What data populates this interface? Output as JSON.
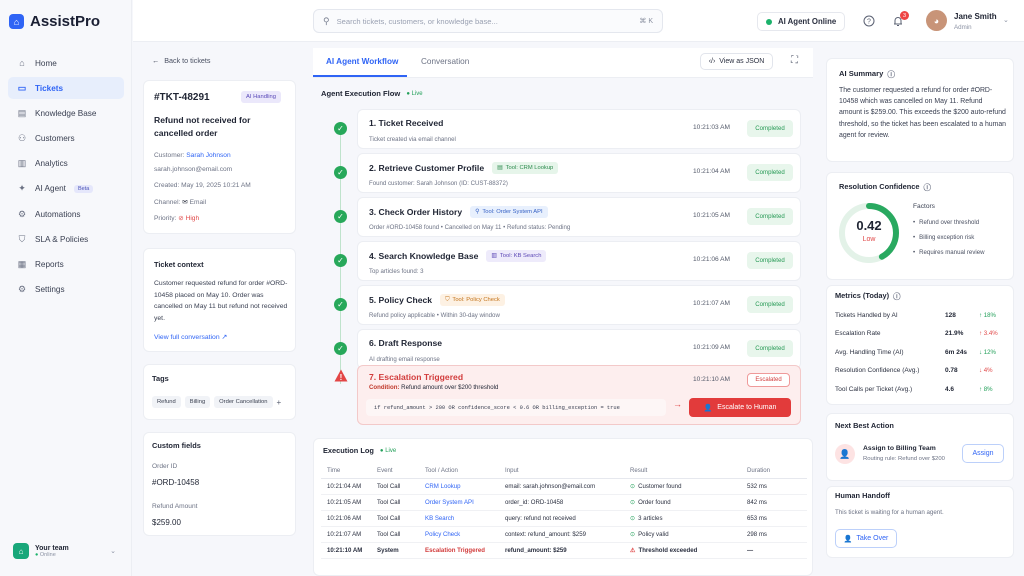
{
  "app": {
    "name": "AssistPro"
  },
  "sidebar": {
    "items": [
      {
        "label": "Home",
        "icon": "home-icon",
        "glyph": "⌂"
      },
      {
        "label": "Tickets",
        "icon": "ticket-icon",
        "glyph": "▭"
      },
      {
        "label": "Knowledge Base",
        "icon": "book-icon",
        "glyph": "▤"
      },
      {
        "label": "Customers",
        "icon": "users-icon",
        "glyph": "⚇"
      },
      {
        "label": "Analytics",
        "icon": "chart-icon",
        "glyph": "▥"
      },
      {
        "label": "AI Agent",
        "icon": "sparkle-icon",
        "glyph": "✦",
        "badge": "Beta"
      },
      {
        "label": "Automations",
        "icon": "gear-icon",
        "glyph": "⚙"
      },
      {
        "label": "SLA & Policies",
        "icon": "shield-icon",
        "glyph": "⛉"
      },
      {
        "label": "Reports",
        "icon": "report-icon",
        "glyph": "▦"
      },
      {
        "label": "Settings",
        "icon": "settings-icon",
        "glyph": "⚙"
      }
    ],
    "active_index": 1
  },
  "team": {
    "name": "Your team",
    "status": "Online"
  },
  "header": {
    "search_placeholder": "Search tickets, customers, or knowledge base...",
    "shortcut": "⌘ K",
    "ai_status": "AI Agent Online",
    "notifications": "3",
    "user_name": "Jane Smith",
    "user_role": "Admin"
  },
  "ticket": {
    "back": "Back to tickets",
    "id": "#TKT-48291",
    "handling": "AI Handling",
    "title": "Refund not received for cancelled order",
    "customer_label": "Customer:",
    "customer": "Sarah Johnson",
    "email": "sarah.johnson@email.com",
    "created": "Created: May 19, 2025 10:21 AM",
    "channel_label": "Channel:",
    "channel": "Email",
    "priority_label": "Priority:",
    "priority": "High"
  },
  "context": {
    "title": "Ticket context",
    "text": "Customer requested refund for order #ORD-10458 placed on May 10. Order was cancelled on May 11 but refund not received yet.",
    "link": "View full conversation"
  },
  "tags": {
    "title": "Tags",
    "items": [
      "Refund",
      "Billing",
      "Order Cancellation"
    ],
    "add": "+"
  },
  "custom": {
    "title": "Custom fields",
    "order_label": "Order ID",
    "order": "#ORD-10458",
    "amount_label": "Refund Amount",
    "amount": "$259.00"
  },
  "main": {
    "tabs": [
      "AI Agent Workflow",
      "Conversation"
    ],
    "view_json": "View as JSON",
    "flow_title": "Agent Execution Flow",
    "live": "Live"
  },
  "steps": [
    {
      "title": "1. Ticket Received",
      "sub": "Ticket created via email channel",
      "time": "10:21:03 AM",
      "status": "Completed"
    },
    {
      "title": "2. Retrieve Customer Profile",
      "tool": "Tool: CRM Lookup",
      "tool_class": "green",
      "tool_glyph": "▤",
      "sub": "Found customer: Sarah Johnson (ID: CUST-88372)",
      "time": "10:21:04 AM",
      "status": "Completed"
    },
    {
      "title": "3. Check Order History",
      "tool": "Tool: Order System API",
      "tool_class": "blue",
      "tool_glyph": "⚲",
      "sub": "Order #ORD-10458 found  •  Cancelled on May 11  •  Refund status: Pending",
      "time": "10:21:05 AM",
      "status": "Completed"
    },
    {
      "title": "4. Search Knowledge Base",
      "tool": "Tool: KB Search",
      "tool_class": "purple",
      "tool_glyph": "▥",
      "sub": "Top articles found: 3",
      "time": "10:21:06 AM",
      "status": "Completed"
    },
    {
      "title": "5. Policy Check",
      "tool": "Tool: Policy Check",
      "tool_class": "orange",
      "tool_glyph": "⛉",
      "sub": "Refund policy applicable  •  Within 30-day window",
      "time": "10:21:07 AM",
      "status": "Completed"
    },
    {
      "title": "6. Draft Response",
      "sub": "AI drafting email response",
      "time": "10:21:09 AM",
      "status": "Completed"
    }
  ],
  "escalation": {
    "title": "7. Escalation Triggered",
    "cond_label": "Condition:",
    "condition": "Refund amount over $200 threshold",
    "time": "10:21:10 AM",
    "status": "Escalated",
    "code": "if refund_amount > 200 OR confidence_score < 0.6 OR billing_exception = true",
    "button": "Escalate to Human"
  },
  "log": {
    "title": "Execution Log",
    "live": "Live",
    "headers": [
      "Time",
      "Event",
      "Tool / Action",
      "Input",
      "Result",
      "Duration"
    ],
    "rows": [
      [
        "10:21:04 AM",
        "Tool Call",
        "CRM Lookup",
        "email: sarah.johnson@email.com",
        "Customer found",
        "532 ms"
      ],
      [
        "10:21:05 AM",
        "Tool Call",
        "Order System API",
        "order_id: ORD-10458",
        "Order found",
        "842 ms"
      ],
      [
        "10:21:06 AM",
        "Tool Call",
        "KB Search",
        "query: refund not received",
        "3 articles",
        "653 ms"
      ],
      [
        "10:21:07 AM",
        "Tool Call",
        "Policy Check",
        "context: refund_amount: $259",
        "Policy valid",
        "298 ms"
      ],
      [
        "10:21:10 AM",
        "System",
        "Escalation Triggered",
        "refund_amount: $259",
        "Threshold exceeded",
        "—"
      ]
    ]
  },
  "summary": {
    "title": "AI Summary",
    "text": "The customer requested a refund for order #ORD-10458 which was cancelled on May 11. Refund amount is $259.00. This exceeds the $200 auto-refund threshold, so the ticket has been escalated to a human agent for review."
  },
  "confidence": {
    "title": "Resolution Confidence",
    "value": "0.42",
    "level": "Low",
    "fraction": 0.42,
    "factors_title": "Factors",
    "factors": [
      "Refund over threshold",
      "Billing exception risk",
      "Requires manual review"
    ]
  },
  "metrics": {
    "title": "Metrics (Today)",
    "rows": [
      {
        "label": "Tickets Handled by AI",
        "value": "128",
        "change": "↑ 18%",
        "dir": "up"
      },
      {
        "label": "Escalation Rate",
        "value": "21.9%",
        "change": "↑ 3.4%",
        "dir": "down"
      },
      {
        "label": "Avg. Handling Time (AI)",
        "value": "6m 24s",
        "change": "↓ 12%",
        "dir": "up"
      },
      {
        "label": "Resolution Confidence (Avg.)",
        "value": "0.78",
        "change": "↓ 4%",
        "dir": "down"
      },
      {
        "label": "Tool Calls per Ticket (Avg.)",
        "value": "4.6",
        "change": "↑ 8%",
        "dir": "up"
      }
    ]
  },
  "next_action": {
    "title": "Next Best Action",
    "action": "Assign to Billing Team",
    "reason": "Routing rule: Refund over $200",
    "button": "Assign"
  },
  "handoff": {
    "title": "Human Handoff",
    "text": "This ticket is waiting for a human agent.",
    "button": "Take Over"
  }
}
